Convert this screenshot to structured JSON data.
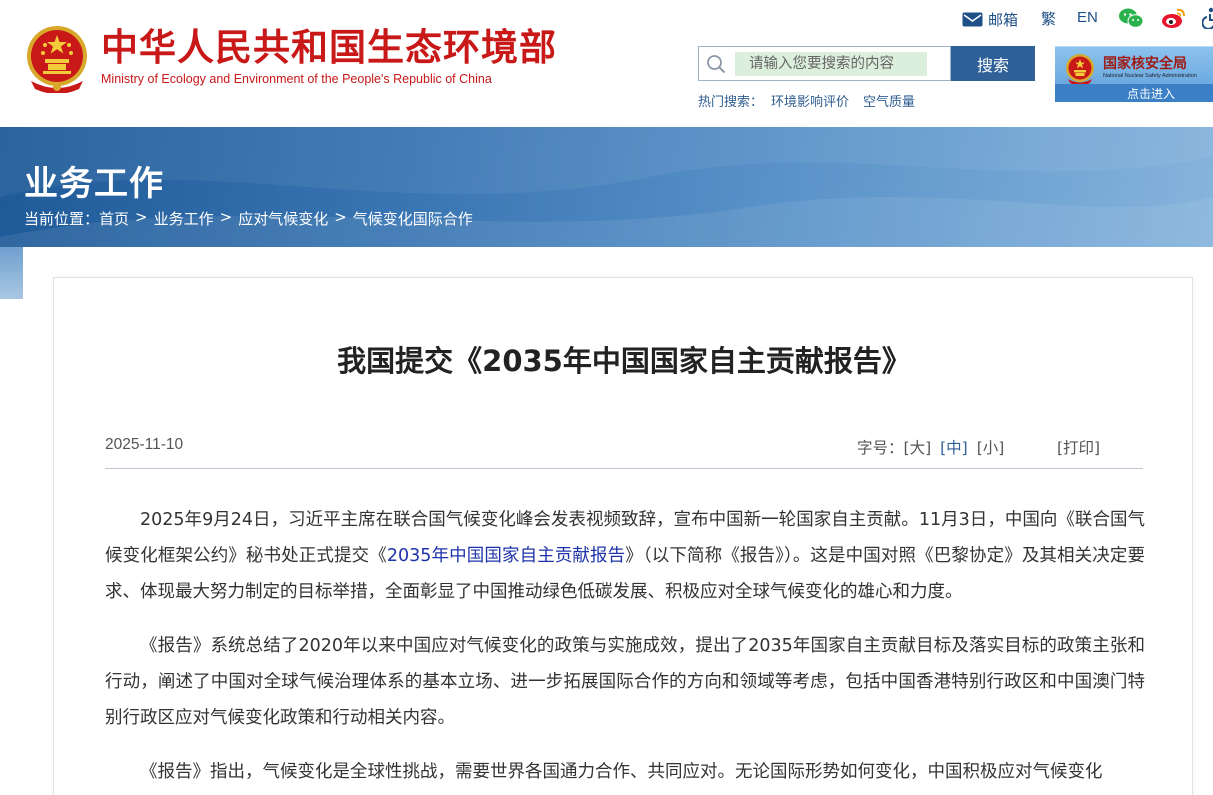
{
  "header": {
    "title_cn": "中华人民共和国生态环境部",
    "title_en": "Ministry of Ecology and Environment of the People's Republic of China",
    "top_links": {
      "mail": "邮箱",
      "traditional": "繁",
      "english": "EN"
    },
    "search": {
      "placeholder": "请输入您要搜索的内容",
      "button_label": "搜索"
    },
    "hot_search": {
      "label": "热门搜索：",
      "items": [
        "环境影响评价",
        "空气质量"
      ]
    },
    "nnsa_banner": {
      "title": "国家核安全局",
      "subtitle": "National Nuclear Safety Administration",
      "enter": "点击进入"
    }
  },
  "banner": {
    "section_title": "业务工作",
    "breadcrumb": {
      "label": "当前位置：",
      "items": [
        "首页",
        "业务工作",
        "应对气候变化",
        "气候变化国际合作"
      ],
      "separator": ">"
    }
  },
  "article": {
    "title": "我国提交《2035年中国国家自主贡献报告》",
    "date": "2025-11-10",
    "font_size": {
      "label": "字号：",
      "large": "[大]",
      "medium": "[中]",
      "small": "[小]"
    },
    "print": "[打印]",
    "paragraphs": [
      {
        "before": "2025年9月24日，习近平主席在联合国气候变化峰会发表视频致辞，宣布中国新一轮国家自主贡献。11月3日，中国向《联合国气候变化框架公约》秘书处正式提交《",
        "link": "2035年中国国家自主贡献报告",
        "after": "》（以下简称《报告》）。这是中国对照《巴黎协定》及其相关决定要求、体现最大努力制定的目标举措，全面彰显了中国推动绿色低碳发展、积极应对全球气候变化的雄心和力度。"
      },
      {
        "text": "《报告》系统总结了2020年以来中国应对气候变化的政策与实施成效，提出了2035年国家自主贡献目标及落实目标的政策主张和行动，阐述了中国对全球气候治理体系的基本立场、进一步拓展国际合作的方向和领域等考虑，包括中国香港特别行政区和中国澳门特别行政区应对气候变化政策和行动相关内容。"
      },
      {
        "text": "《报告》指出，气候变化是全球性挑战，需要世界各国通力合作、共同应对。无论国际形势如何变化，中国积极应对气候变化"
      }
    ]
  },
  "colors": {
    "brand_red": "#c81818",
    "primary_blue": "#2f6097",
    "link_blue": "#1f33a9",
    "search_input_bg": "#dcefdc"
  }
}
